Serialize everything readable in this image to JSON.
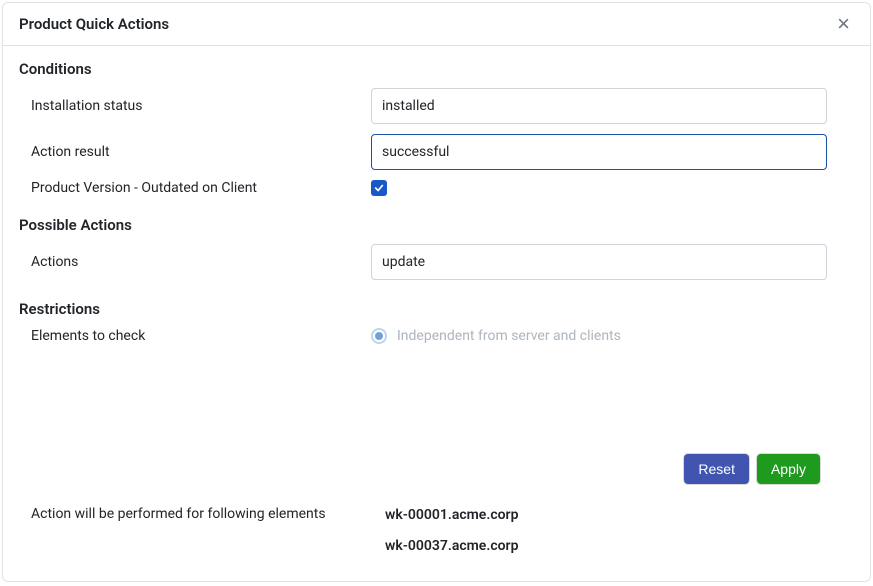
{
  "header": {
    "title": "Product Quick Actions"
  },
  "sections": {
    "conditions": {
      "heading": "Conditions",
      "install_status_label": "Installation status",
      "install_status_value": "installed",
      "action_result_label": "Action result",
      "action_result_value": "successful",
      "outdated_label": "Product Version - Outdated on Client",
      "outdated_checked": true
    },
    "possible_actions": {
      "heading": "Possible Actions",
      "actions_label": "Actions",
      "actions_value": "update"
    },
    "restrictions": {
      "heading": "Restrictions",
      "elements_label": "Elements to check",
      "radio_label": "Independent from server and clients"
    }
  },
  "buttons": {
    "reset": "Reset",
    "apply": "Apply"
  },
  "summary": {
    "label": "Action will be performed for following elements",
    "items": [
      "wk-00001.acme.corp",
      "wk-00037.acme.corp"
    ]
  }
}
